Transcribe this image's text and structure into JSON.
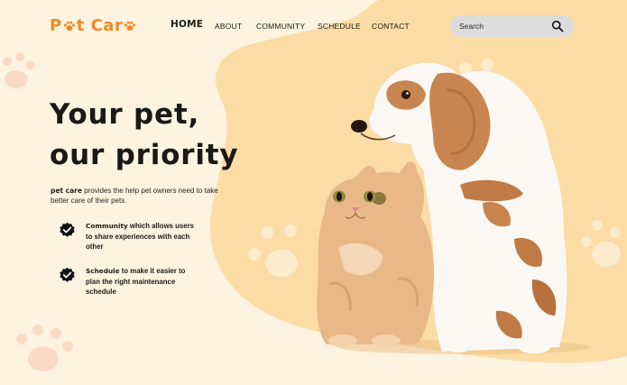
{
  "brand": {
    "logo_part1": "P",
    "logo_part2": "t Car",
    "logo_icon": "paw-icon",
    "accent_color": "#f08a24",
    "blob_color": "#fbd9a0",
    "background_color": "#fdf3e0"
  },
  "nav": {
    "items": [
      {
        "label": "HOME",
        "active": true
      },
      {
        "label": "ABOUT",
        "active": false
      },
      {
        "label": "COMMUNITY",
        "active": false
      },
      {
        "label": "SCHEDULE",
        "active": false
      },
      {
        "label": "CONTACT",
        "active": false
      }
    ]
  },
  "search": {
    "placeholder": "Search",
    "icon": "search-icon"
  },
  "hero": {
    "title_line1": "Your pet,",
    "title_line2": "our priority",
    "description_strong": "pet care",
    "description_rest": " provides the help pet owners need to take better care of their pets.",
    "features": [
      {
        "icon": "check-badge-icon",
        "strong": "Community",
        "rest": " which allows users to share experiences with each other"
      },
      {
        "icon": "check-badge-icon",
        "strong": "Schedule",
        "rest": " to make it easier to plan the right maintenance schedule"
      }
    ],
    "image_subject": "kitten and puppy"
  }
}
